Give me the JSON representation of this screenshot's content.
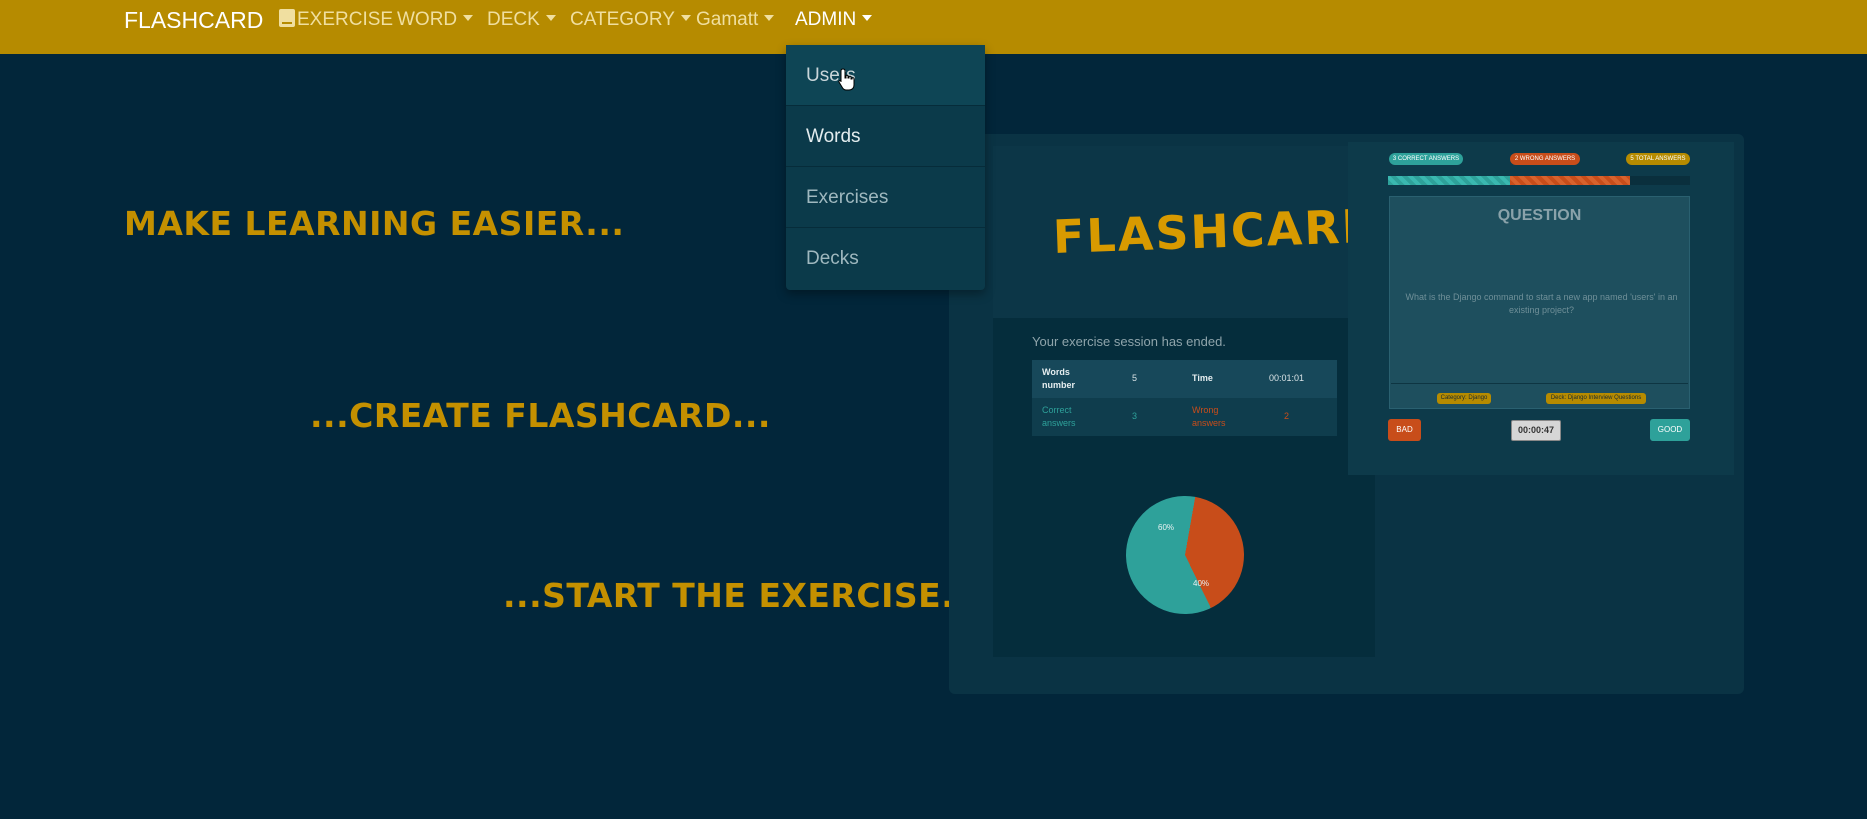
{
  "navbar": {
    "brand": "FLASHCARD",
    "items": [
      {
        "label": "EXERCISE",
        "icon": "book-icon"
      },
      {
        "label": "WORD"
      },
      {
        "label": "DECK"
      },
      {
        "label": "CATEGORY"
      },
      {
        "label": "Gamatt"
      },
      {
        "label": "ADMIN"
      }
    ]
  },
  "admin_dropdown": {
    "items": [
      {
        "label": "Users"
      },
      {
        "label": "Words"
      },
      {
        "label": "Exercises"
      },
      {
        "label": "Decks"
      }
    ]
  },
  "hero": {
    "line1": "MAKE LEARNING EASIER...",
    "line2": "...CREATE FLASHCARD...",
    "line3": "...START THE EXERCISE."
  },
  "preview": {
    "logo": "FLASHCARD",
    "session_message": "Your exercise session has ended.",
    "results_table": {
      "words_number_label": "Words number",
      "words_number_value": "5",
      "time_label": "Time",
      "time_value": "00:01:01",
      "correct_label": "Correct answers",
      "correct_value": "3",
      "wrong_label": "Wrong answers",
      "wrong_value": "2"
    },
    "pie": {
      "correct_pct": "60%",
      "wrong_pct": "40%"
    },
    "exercise": {
      "badge_correct": "3 CORRECT ANSWERS",
      "badge_wrong": "2 WRONG ANSWERS",
      "badge_total": "5 TOTAL ANSWERS",
      "question_title": "QUESTION",
      "question_text": "What is the Django command to start a new app named 'users' in an existing project?",
      "tag_category": "Category: Django",
      "tag_deck": "Deck: Django Interview Questions",
      "bad_label": "BAD",
      "timer": "00:00:47",
      "good_label": "GOOD"
    },
    "colors": {
      "teal": "#2ea19a",
      "red": "#c84d1a",
      "gold": "#b68b00"
    }
  }
}
